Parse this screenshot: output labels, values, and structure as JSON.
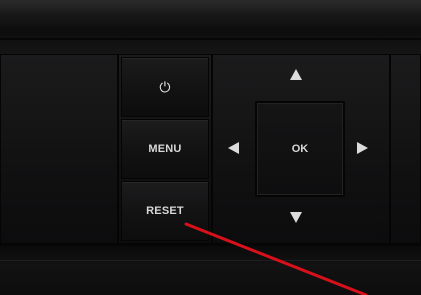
{
  "device": {
    "buttons": {
      "power_icon": "power-icon",
      "menu_label": "MENU",
      "reset_label": "RESET",
      "ok_label": "OK"
    },
    "dpad_icons": [
      "arrow-up-icon",
      "arrow-down-icon",
      "arrow-left-icon",
      "arrow-right-icon"
    ]
  },
  "annotation": {
    "type": "pointer-line",
    "target": "reset-button",
    "color": "#d8101a"
  },
  "colors": {
    "panel": "#111112",
    "label": "#d8d8d8",
    "annotation": "#d8101a"
  }
}
